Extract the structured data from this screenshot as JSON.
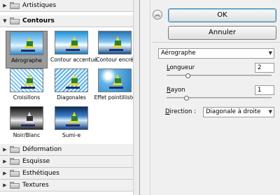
{
  "categories_top": [
    {
      "label": "Artistiques",
      "expanded": false
    },
    {
      "label": "Contours",
      "expanded": true
    }
  ],
  "filters": [
    {
      "label": "Aérographe",
      "selected": true
    },
    {
      "label": "Contour accentué",
      "selected": false
    },
    {
      "label": "Contour encré",
      "selected": false
    },
    {
      "label": "Croisillons",
      "selected": false
    },
    {
      "label": "Diagonales",
      "selected": false
    },
    {
      "label": "Effet pointilliste",
      "selected": false
    },
    {
      "label": "Noir/Blanc",
      "selected": false
    },
    {
      "label": "Sumi-e",
      "selected": false
    }
  ],
  "categories_bottom": [
    {
      "label": "Déformation"
    },
    {
      "label": "Esquisse"
    },
    {
      "label": "Esthétiques"
    },
    {
      "label": "Textures"
    }
  ],
  "buttons": {
    "ok": "OK",
    "cancel": "Annuler"
  },
  "settings": {
    "filter_select": "Aérographe",
    "length_label_accel": "L",
    "length_label_rest": "ongueur",
    "length_value": "2",
    "radius_label_accel": "R",
    "radius_label_rest": "ayon",
    "radius_value": "1",
    "direction_label_accel": "D",
    "direction_label_rest": "irection :",
    "direction_value": "Diagonale à droite"
  },
  "icons": {
    "collapse": "double-chevron-up-icon",
    "folder": "folder-icon",
    "expand_arrow": "triangle-right-icon",
    "collapse_arrow": "triangle-down-icon"
  },
  "colors": {
    "selected_thumb_bg": "#9c9c9c",
    "ok_border": "#3c7fb1"
  }
}
